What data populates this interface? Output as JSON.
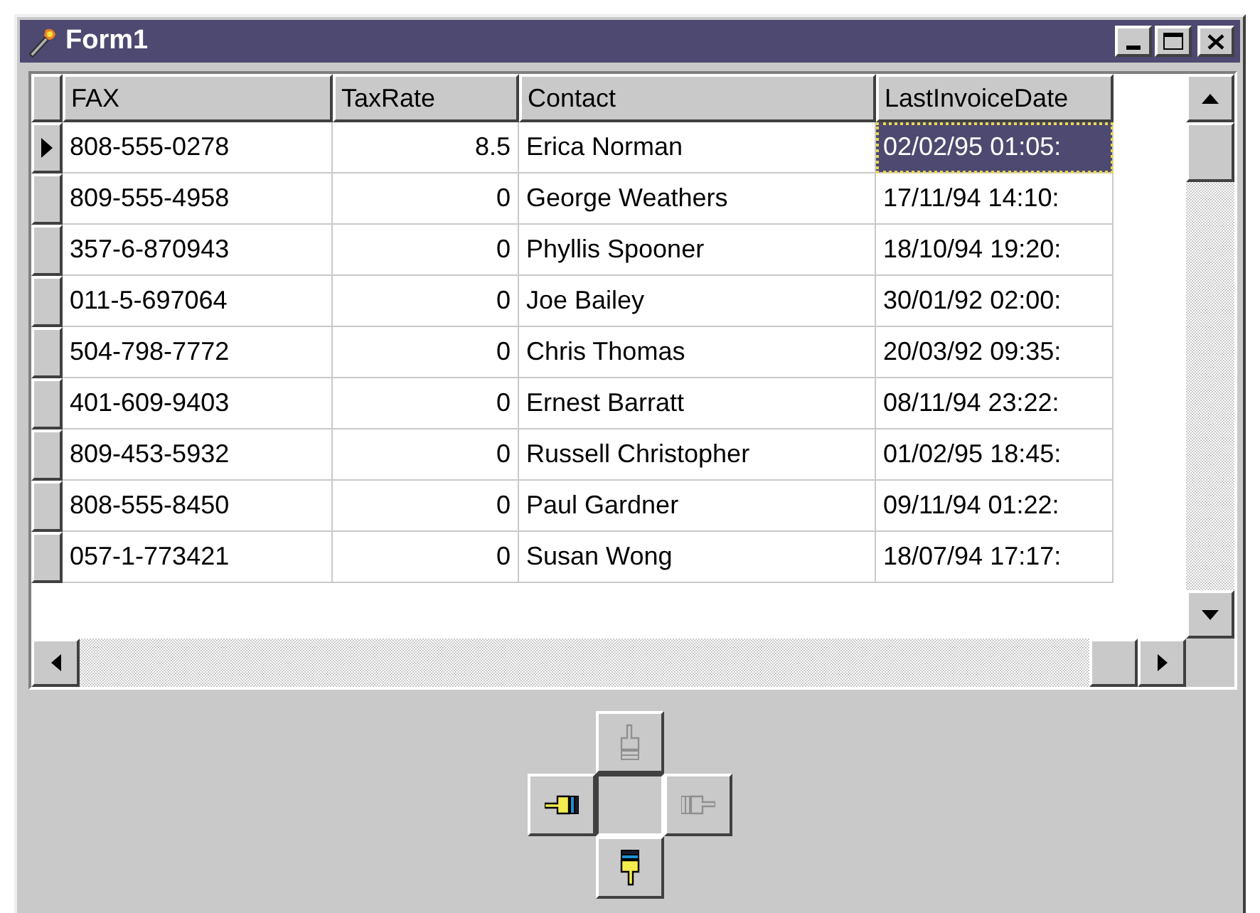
{
  "window": {
    "title": "Form1"
  },
  "table": {
    "columns": [
      "FAX",
      "TaxRate",
      "Contact",
      "LastInvoiceDate"
    ],
    "rows": [
      {
        "cells": [
          "808-555-0278",
          "8.5",
          "Erica Norman",
          "02/02/95 01:05:"
        ],
        "selected": true
      },
      {
        "cells": [
          "809-555-4958",
          "0",
          "George Weathers",
          "17/11/94 14:10:"
        ],
        "selected": false
      },
      {
        "cells": [
          "357-6-870943",
          "0",
          "Phyllis Spooner",
          "18/10/94 19:20:"
        ],
        "selected": false
      },
      {
        "cells": [
          "011-5-697064",
          "0",
          "Joe Bailey",
          "30/01/92 02:00:"
        ],
        "selected": false
      },
      {
        "cells": [
          "504-798-7772",
          "0",
          "Chris Thomas",
          "20/03/92 09:35:"
        ],
        "selected": false
      },
      {
        "cells": [
          "401-609-9403",
          "0",
          "Ernest Barratt",
          "08/11/94 23:22:"
        ],
        "selected": false
      },
      {
        "cells": [
          "809-453-5932",
          "0",
          "Russell Christopher",
          "01/02/95 18:45:"
        ],
        "selected": false
      },
      {
        "cells": [
          "808-555-8450",
          "0",
          "Paul Gardner",
          "09/11/94 01:22:"
        ],
        "selected": false
      },
      {
        "cells": [
          "057-1-773421",
          "0",
          "Susan Wong",
          "18/07/94 17:17:"
        ],
        "selected": false
      }
    ]
  },
  "nav_buttons": [
    {
      "kind": "up",
      "disabled": true
    },
    {
      "kind": "left",
      "disabled": false
    },
    {
      "kind": "right",
      "disabled": true
    },
    {
      "kind": "down",
      "disabled": false
    }
  ]
}
